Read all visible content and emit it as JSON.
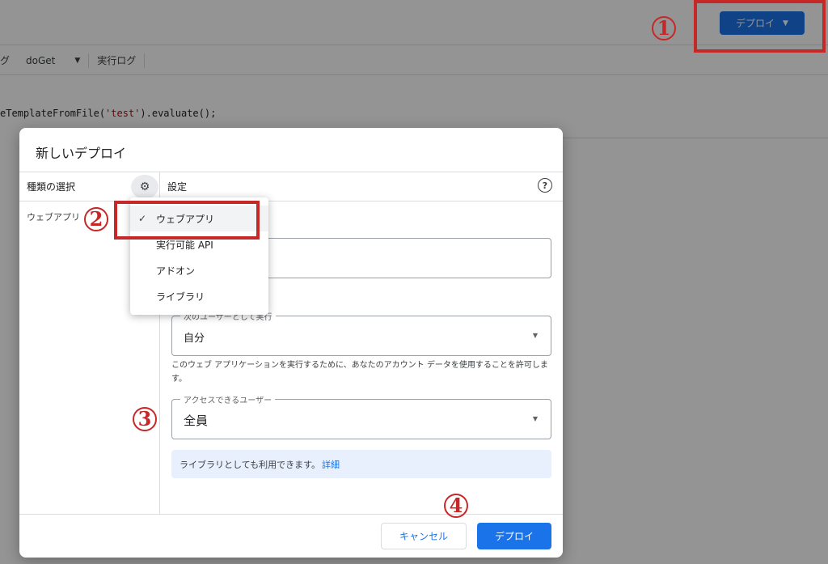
{
  "editor": {
    "deploy_label": "デプロイ",
    "toolbar_partial": "グ",
    "function_name": "doGet",
    "exec_log_label": "実行ログ",
    "code_before": "eTemplateFromFile(",
    "code_string": "'test'",
    "code_after": ").evaluate();"
  },
  "dialog": {
    "title": "新しいデプロイ",
    "left_header": "種類の選択",
    "left_item": "ウェブアプリ",
    "settings_header": "設定",
    "execute_as": {
      "label": "次のユーザーとして実行",
      "value": "自分"
    },
    "description": "このウェブ アプリケーションを実行するために、あなたのアカウント データを使用することを許可します。",
    "access": {
      "label": "アクセスできるユーザー",
      "value": "全員"
    },
    "info_text": "ライブラリとしても利用できます。",
    "info_link": "詳細",
    "cancel_label": "キャンセル",
    "deploy_label": "デプロイ"
  },
  "menu": {
    "items": [
      {
        "label": "ウェブアプリ",
        "selected": true
      },
      {
        "label": "実行可能 API",
        "selected": false
      },
      {
        "label": "アドオン",
        "selected": false
      },
      {
        "label": "ライブラリ",
        "selected": false
      }
    ]
  },
  "annotations": {
    "step1": "1",
    "step2": "2",
    "step3": "3",
    "step4": "4",
    "color": "#c62828"
  },
  "colors": {
    "accent": "#1a73e8",
    "info_bg": "#e8f0fe"
  }
}
